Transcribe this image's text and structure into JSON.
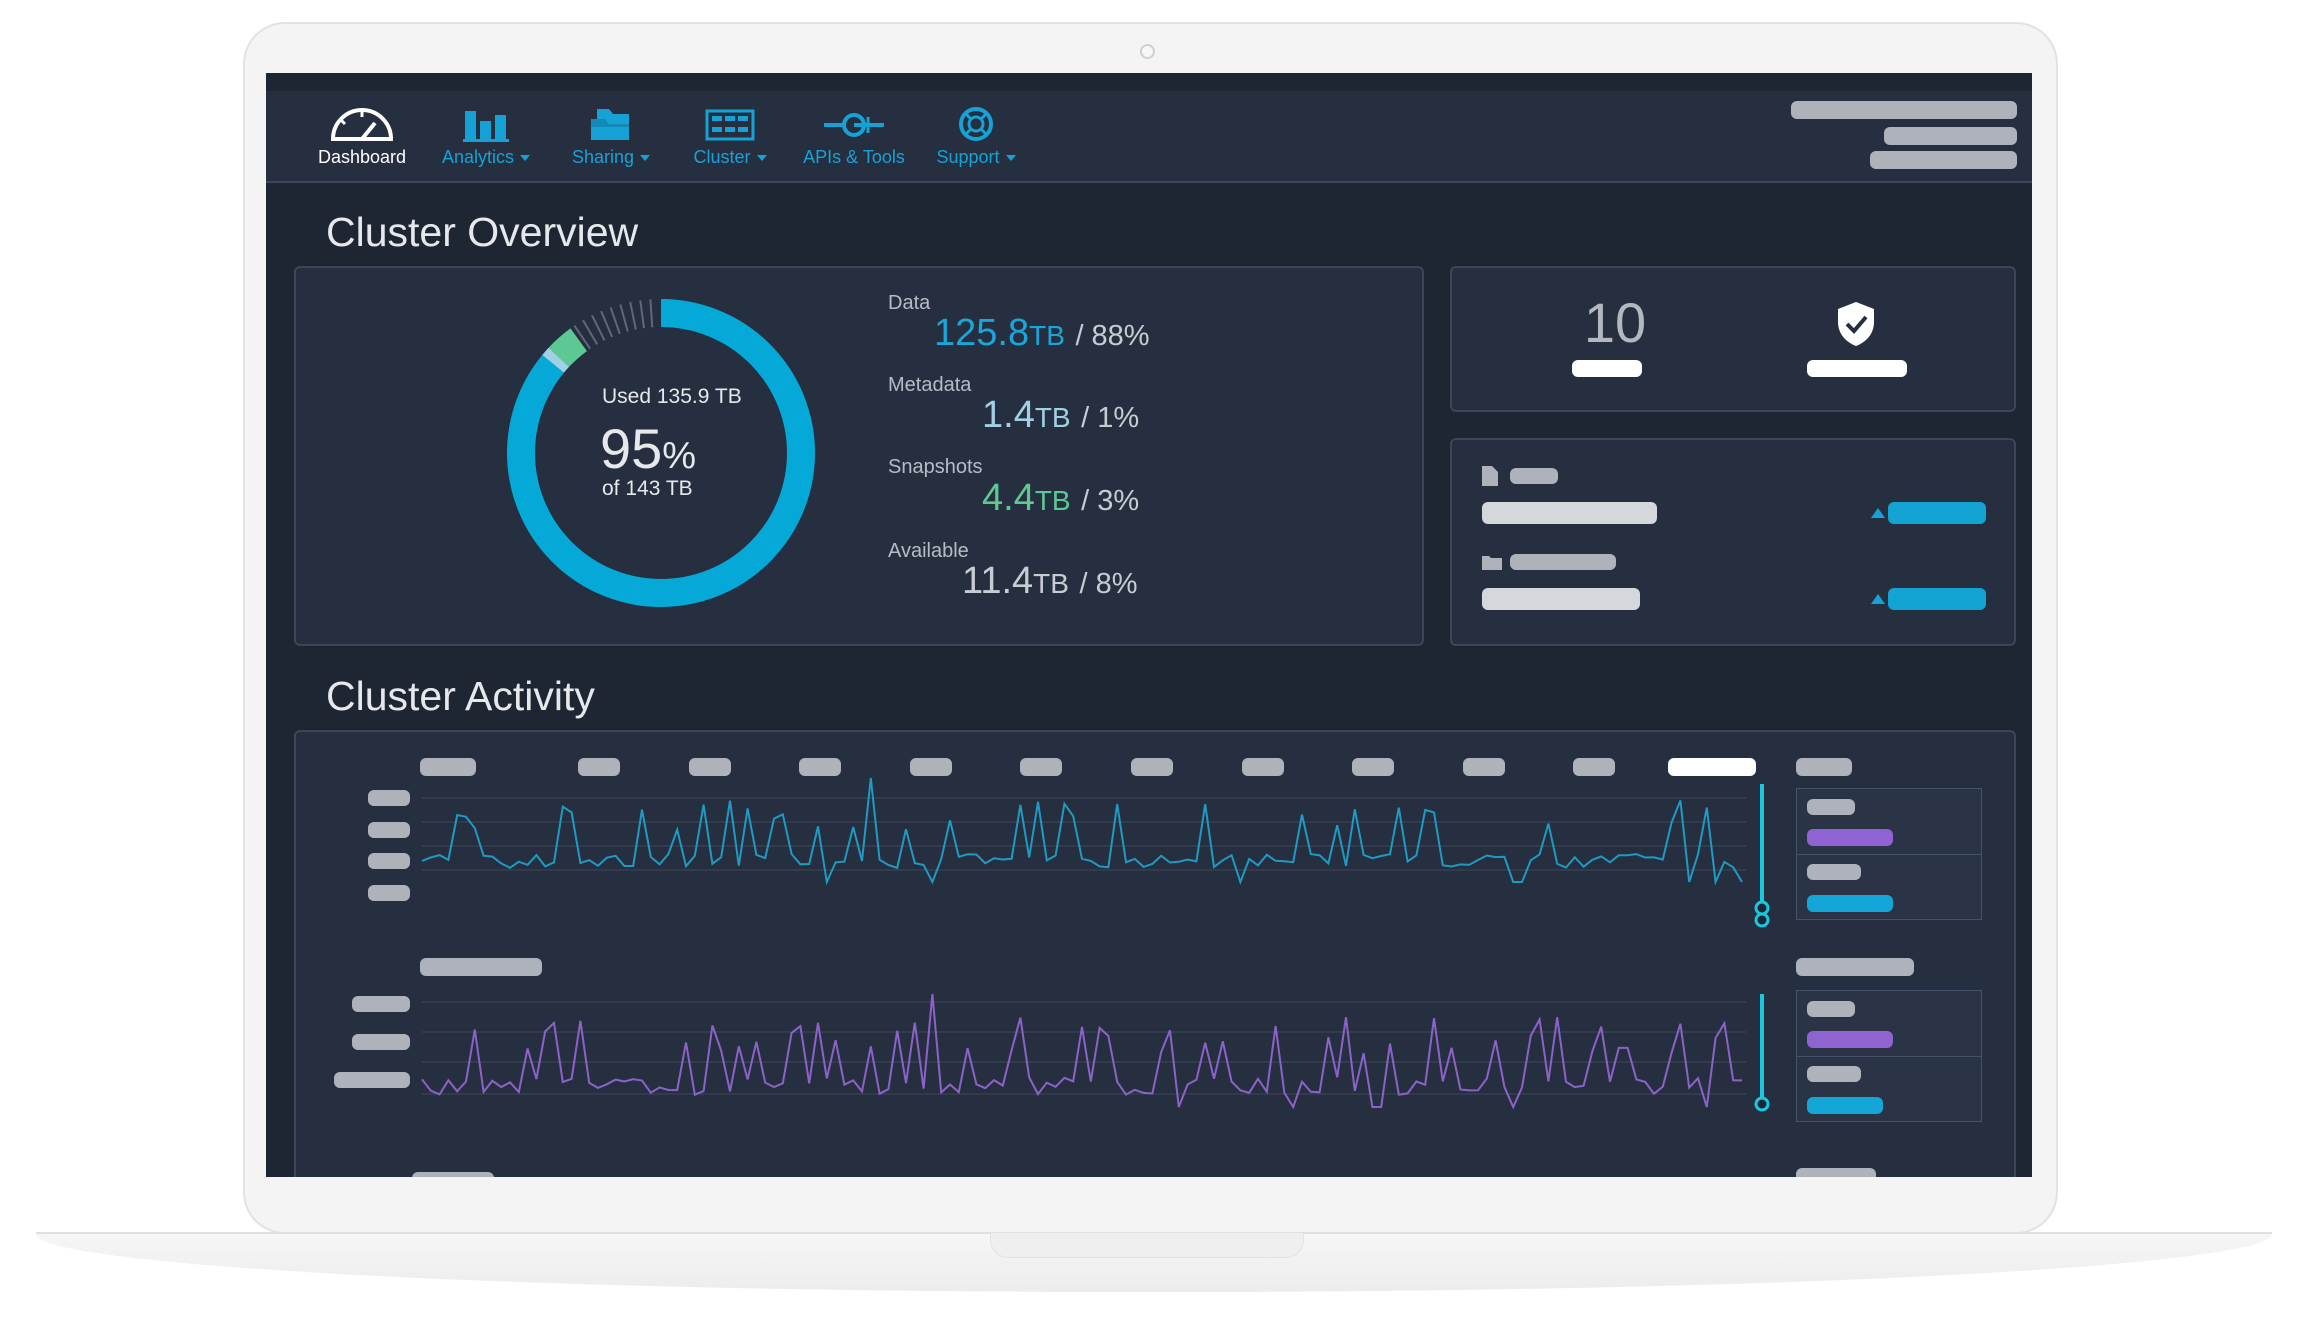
{
  "nav": {
    "items": [
      {
        "label": "Dashboard",
        "active": true,
        "icon": "speedometer-icon",
        "dropdown": false
      },
      {
        "label": "Analytics",
        "active": false,
        "icon": "bar-chart-icon",
        "dropdown": true
      },
      {
        "label": "Sharing",
        "active": false,
        "icon": "shared-folders-icon",
        "dropdown": true
      },
      {
        "label": "Cluster",
        "active": false,
        "icon": "server-rack-icon",
        "dropdown": true
      },
      {
        "label": "APIs & Tools",
        "active": false,
        "icon": "plug-connector-icon",
        "dropdown": false
      },
      {
        "label": "Support",
        "active": false,
        "icon": "lifebuoy-icon",
        "dropdown": true
      }
    ]
  },
  "overview": {
    "title": "Cluster Overview",
    "capacity": {
      "used_label": "Used 135.9 TB",
      "percent": "95",
      "percent_sign": "%",
      "total_label": "of 143 TB",
      "used_fraction": 0.95
    },
    "stats": [
      {
        "label": "Data",
        "value": "125.8",
        "unit": "TB",
        "share": "/ 88%",
        "color": "#1aa6d9"
      },
      {
        "label": "Metadata",
        "value": "1.4",
        "unit": "TB",
        "share": "/ 1%",
        "color": "#9fd0e3"
      },
      {
        "label": "Snapshots",
        "value": "4.4",
        "unit": "TB",
        "share": "/ 3%",
        "color": "#5cc892"
      },
      {
        "label": "Available",
        "value": "11.4",
        "unit": "TB",
        "share": "/ 8%",
        "color": "#c7ccd3"
      }
    ],
    "summary": {
      "count": "10",
      "shield_icon": "shield-check-icon"
    },
    "file_icons": [
      "file-icon",
      "folder-icon"
    ]
  },
  "activity": {
    "title": "Cluster Activity",
    "colors": {
      "primary": "#1f9ac2",
      "secondary": "#8d62c8",
      "cursor": "#19c8e0",
      "legend_purple": "#8f63d1",
      "legend_blue": "#14a6d6"
    }
  },
  "colors": {
    "accent": "#16a2d7",
    "snapshots": "#5cc892",
    "background": "#1e2633",
    "panel": "#262f40"
  }
}
